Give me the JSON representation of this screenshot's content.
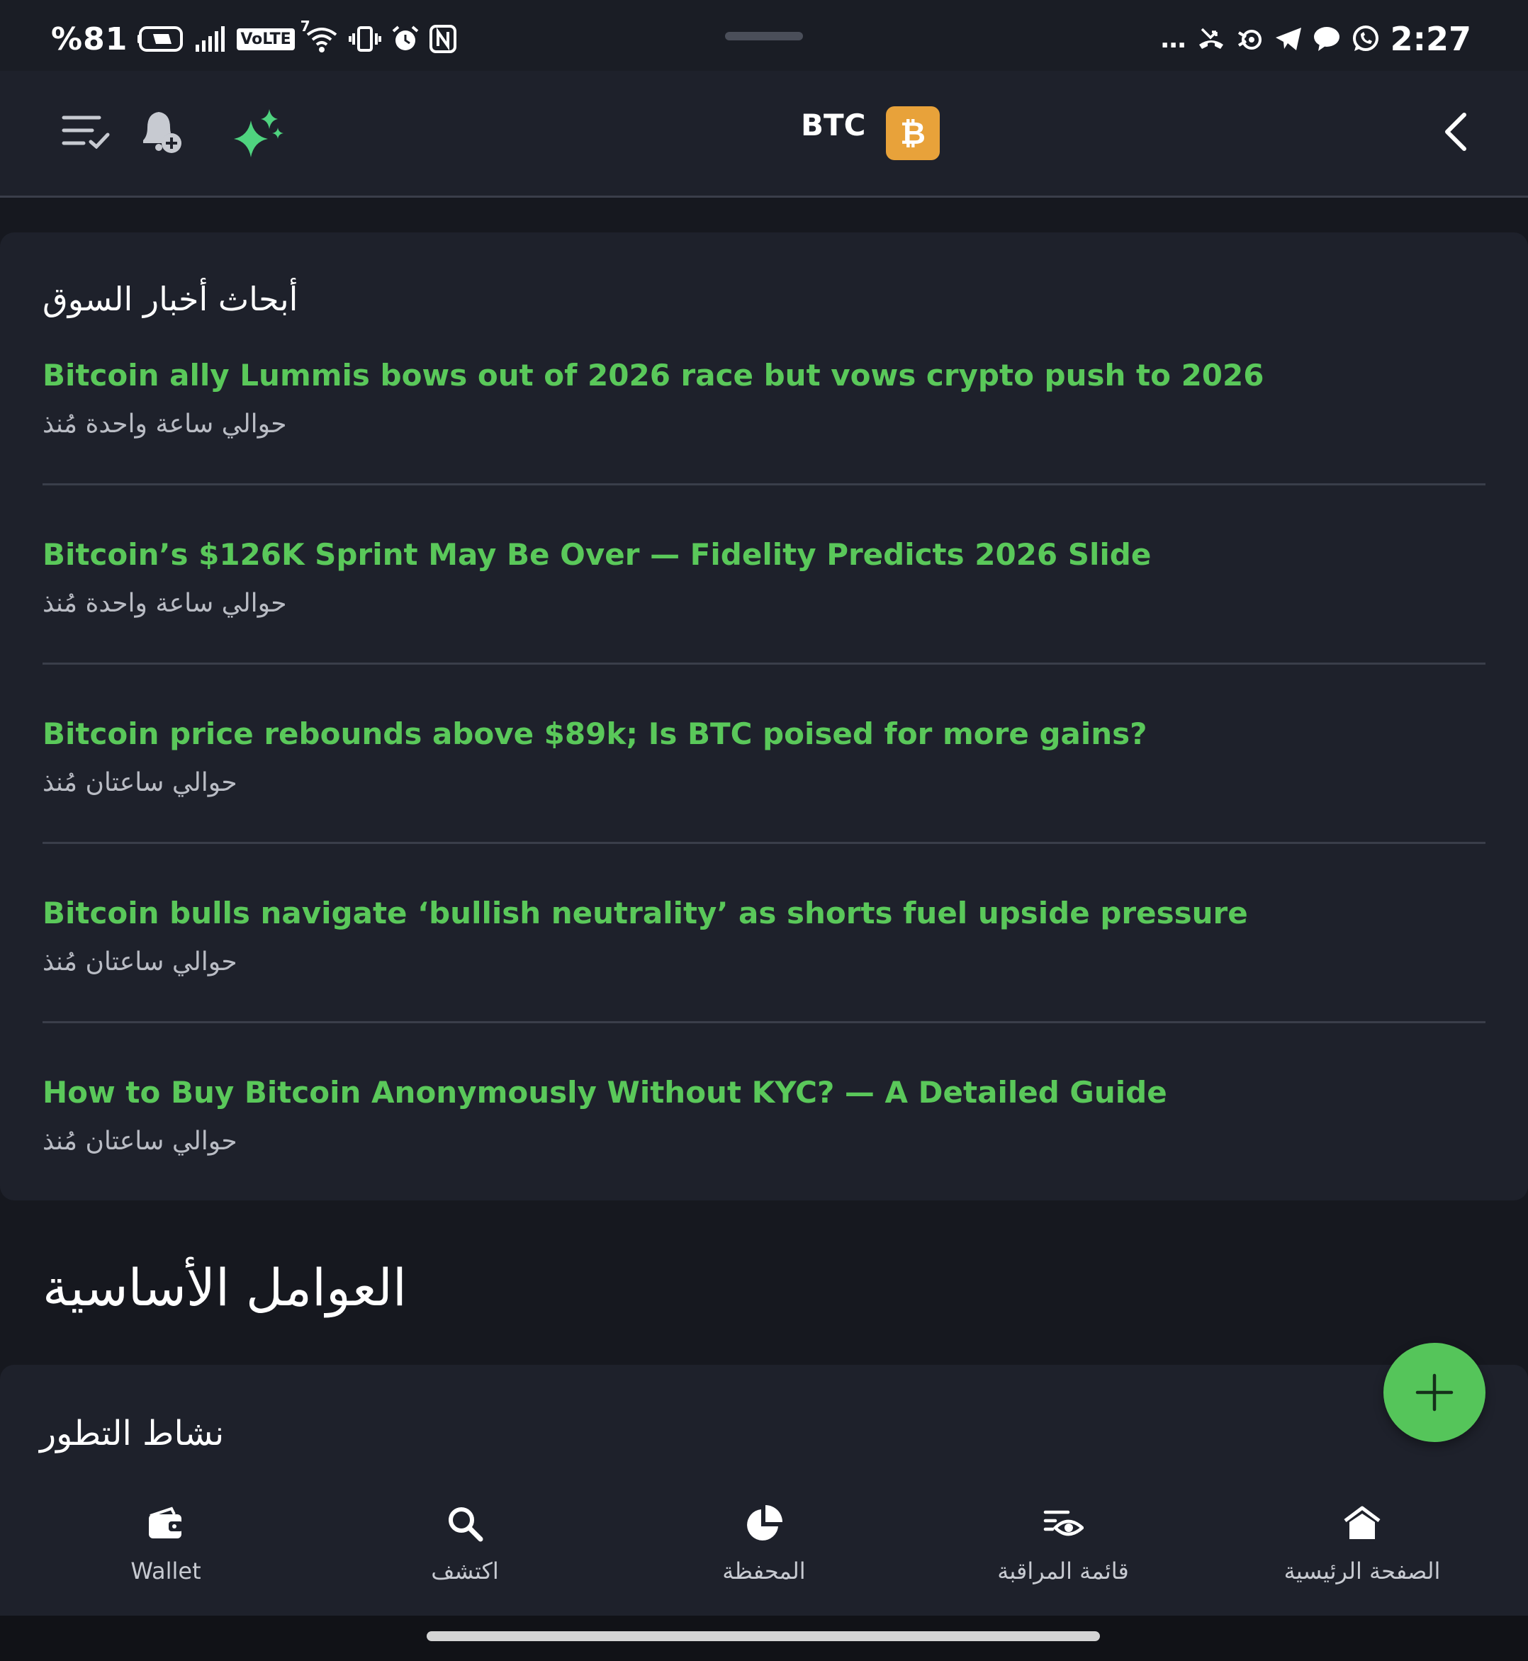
{
  "status_bar": {
    "battery": "%81",
    "time": "2:27",
    "volte": "VoLTE",
    "wifi_superscript": "7",
    "overflow": "…"
  },
  "header": {
    "coin_symbol": "BTC",
    "coin_logo_glyph": "₿",
    "accent_color": "#e8a23a"
  },
  "news": {
    "section_title": "أبحاث أخبار السوق",
    "headline_color": "#5ac85a",
    "items": [
      {
        "headline": "Bitcoin ally Lummis bows out of 2026 race but vows crypto push to 2026",
        "time": "حوالي ساعة واحدة مُنذ"
      },
      {
        "headline": "Bitcoin’s $126K Sprint May Be Over — Fidelity Predicts 2026 Slide",
        "time": "حوالي ساعة واحدة مُنذ"
      },
      {
        "headline": "Bitcoin price rebounds above $89k; Is BTC poised for more gains?",
        "time": "حوالي ساعتان مُنذ"
      },
      {
        "headline": "Bitcoin bulls navigate ‘bullish neutrality’ as shorts fuel upside pressure",
        "time": "حوالي ساعتان مُنذ"
      },
      {
        "headline": "How to Buy Bitcoin Anonymously Without KYC? — A Detailed Guide",
        "time": "حوالي ساعتان مُنذ"
      }
    ]
  },
  "fundamentals": {
    "title": "العوامل الأساسية",
    "dev_activity_title": "نشاط التطور"
  },
  "fab": {
    "icon": "plus-icon",
    "color": "#55c55a"
  },
  "bottom_nav": {
    "items": [
      {
        "label": "Wallet",
        "icon": "wallet-icon"
      },
      {
        "label": "اكتشف",
        "icon": "search-icon"
      },
      {
        "label": "المحفظة",
        "icon": "pie-chart-icon"
      },
      {
        "label": "قائمة المراقبة",
        "icon": "watchlist-icon"
      },
      {
        "label": "الصفحة الرئيسية",
        "icon": "home-icon"
      }
    ]
  }
}
